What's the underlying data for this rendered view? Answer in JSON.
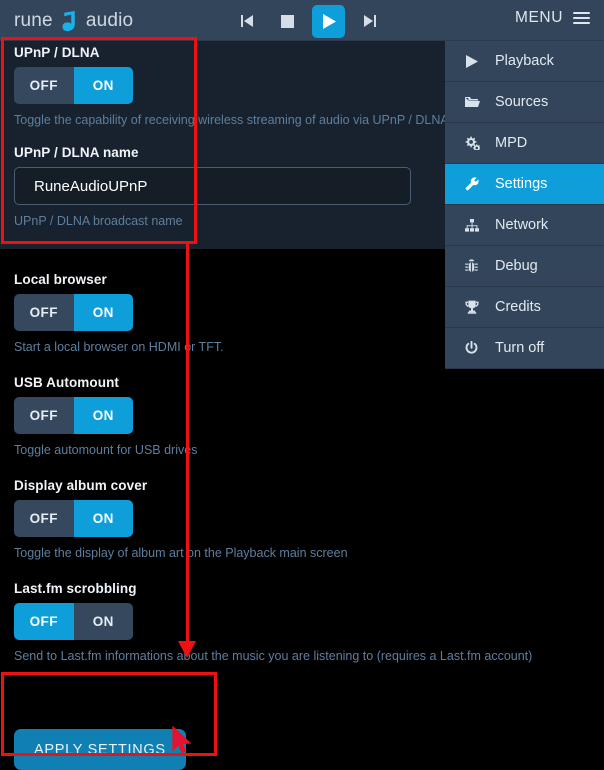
{
  "header": {
    "logo": {
      "word1": "rune",
      "word2": "audio",
      "mark": "runeaudio-logo-icon"
    },
    "transport": [
      {
        "name": "previous-track-button",
        "glyph": "⏮",
        "active": false
      },
      {
        "name": "stop-button",
        "glyph": "■",
        "active": false
      },
      {
        "name": "play-button",
        "glyph": "▶",
        "active": true
      },
      {
        "name": "next-track-button",
        "glyph": "⏭",
        "active": false
      }
    ],
    "menu_label": "MENU"
  },
  "sidebar": {
    "items": [
      {
        "label": "Playback",
        "icon": "play-icon",
        "glyph": "▶",
        "active": false
      },
      {
        "label": "Sources",
        "icon": "folder-open-icon",
        "glyph": "📁",
        "active": false
      },
      {
        "label": "MPD",
        "icon": "gears-icon",
        "glyph": "⚙",
        "active": false
      },
      {
        "label": "Settings",
        "icon": "wrench-icon",
        "glyph": "🔧",
        "active": true
      },
      {
        "label": "Network",
        "icon": "sitemap-icon",
        "glyph": "⑂",
        "active": false
      },
      {
        "label": "Debug",
        "icon": "bug-icon",
        "glyph": "🐛",
        "active": false
      },
      {
        "label": "Credits",
        "icon": "trophy-icon",
        "glyph": "🏆",
        "active": false
      },
      {
        "label": "Turn off",
        "icon": "power-icon",
        "glyph": "⏻",
        "active": false
      }
    ]
  },
  "settings": {
    "upnp": {
      "label": "UPnP / DLNA",
      "off_label": "OFF",
      "on_label": "ON",
      "value": "ON",
      "help": "Toggle the capability of receiving wireless streaming of audio via UPnP / DLNA"
    },
    "upnp_name": {
      "label": "UPnP / DLNA name",
      "value": "RuneAudioUPnP",
      "placeholder": "UPnP / DLNA name",
      "help": "UPnP / DLNA broadcast name"
    },
    "local_browser": {
      "label": "Local browser",
      "off_label": "OFF",
      "on_label": "ON",
      "value": "ON",
      "help": "Start a local browser on HDMI or TFT."
    },
    "usb_automount": {
      "label": "USB Automount",
      "off_label": "OFF",
      "on_label": "ON",
      "value": "ON",
      "help": "Toggle automount for USB drives"
    },
    "album_cover": {
      "label": "Display album cover",
      "off_label": "OFF",
      "on_label": "ON",
      "value": "ON",
      "help": "Toggle the display of album art on the Playback main screen"
    },
    "lastfm": {
      "label": "Last.fm scrobbling",
      "off_label": "OFF",
      "on_label": "ON",
      "value": "OFF",
      "help": "Send to Last.fm informations about the music you are listening to (requires a Last.fm account)"
    },
    "apply_label": "APPLY SETTINGS"
  },
  "colors": {
    "accent": "#0e9fdb",
    "header_bg": "#33455b",
    "panel_bg": "#18222e",
    "page_bg": "#000000",
    "annotation": "#ee1111",
    "help_text": "#5d7f9e"
  }
}
